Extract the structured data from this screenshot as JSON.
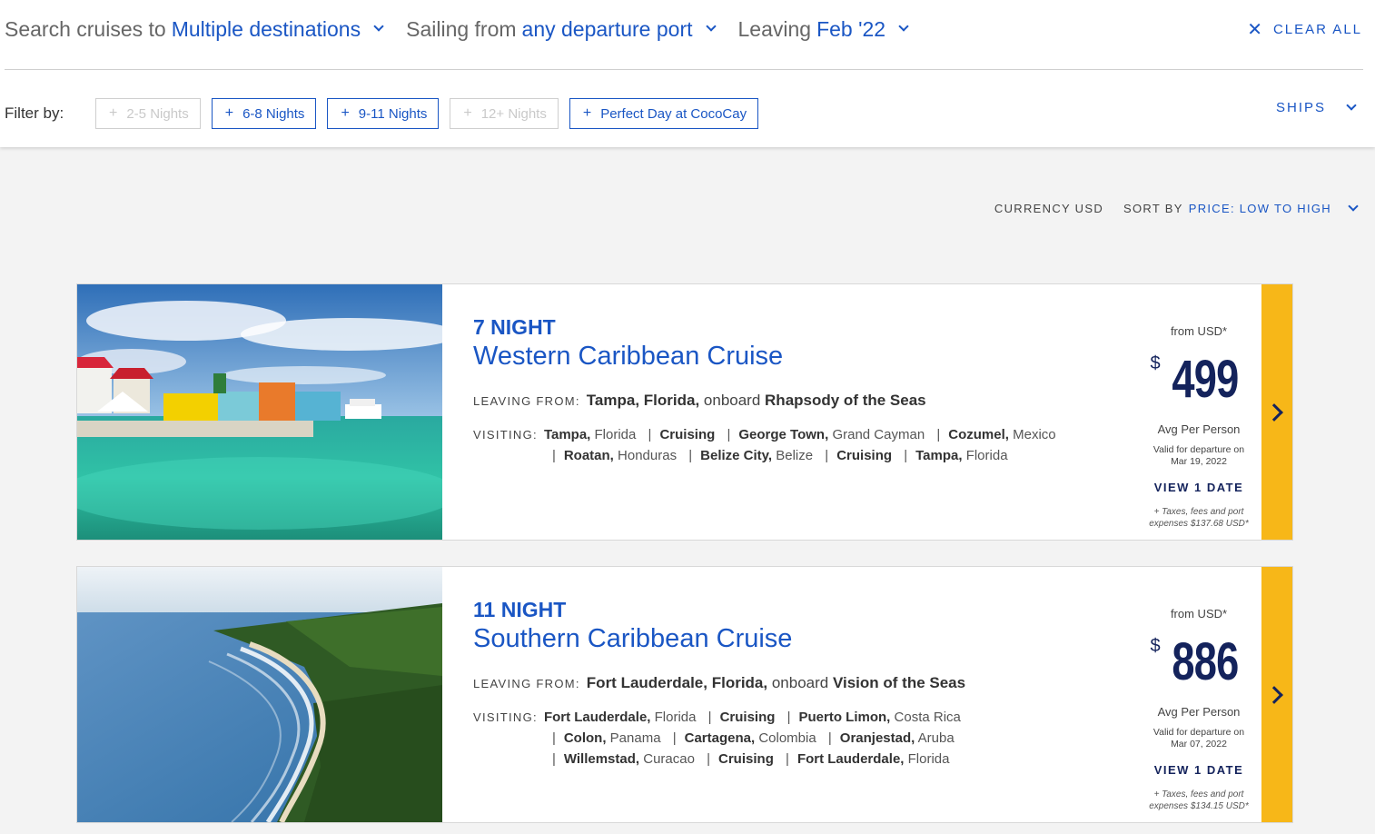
{
  "search": {
    "destination_prefix": "Search cruises to",
    "destination_value": "Multiple destinations",
    "port_prefix": "Sailing from",
    "port_value": "any departure port",
    "date_prefix": "Leaving",
    "date_value": "Feb '22",
    "clear_icon": "✕",
    "clear_label": "CLEAR ALL"
  },
  "filters": {
    "label": "Filter by:",
    "chips": [
      {
        "label": "2-5 Nights",
        "enabled": false
      },
      {
        "label": "6-8 Nights",
        "enabled": true
      },
      {
        "label": "9-11 Nights",
        "enabled": true
      },
      {
        "label": "12+ Nights",
        "enabled": false
      },
      {
        "label": "Perfect Day at CocoCay",
        "enabled": true
      }
    ],
    "plus": "+",
    "ships_label": "SHIPS"
  },
  "sort": {
    "currency": "CURRENCY USD",
    "sort_prefix": "SORT BY",
    "sort_value": "PRICE: LOW TO HIGH"
  },
  "colors": {
    "brand_blue": "#1a56c4",
    "navy": "#14235c",
    "accent_yellow": "#f7b718"
  },
  "cruises": [
    {
      "nights": "7 NIGHT",
      "name": "Western Caribbean Cruise",
      "leaving_label": "LEAVING FROM:",
      "leaving_city": "Tampa, Florida,",
      "onboard": "onboard",
      "ship": "Rhapsody of the Seas",
      "visiting_label": "VISITING:",
      "ports": [
        {
          "city": "Tampa,",
          "region": "Florida"
        },
        {
          "city": "Cruising",
          "region": ""
        },
        {
          "city": "George Town,",
          "region": "Grand Cayman"
        },
        {
          "city": "Cozumel,",
          "region": "Mexico"
        },
        {
          "city": "Roatan,",
          "region": "Honduras"
        },
        {
          "city": "Belize City,",
          "region": "Belize"
        },
        {
          "city": "Cruising",
          "region": ""
        },
        {
          "city": "Tampa,",
          "region": "Florida"
        }
      ],
      "from_label": "from USD*",
      "currency_symbol": "$",
      "price": "499",
      "avg_label": "Avg Per Person",
      "valid_line1": "Valid for departure on",
      "valid_line2": "Mar 19, 2022",
      "view_label": "VIEW 1 DATE",
      "taxes_line1": "+ Taxes, fees and port",
      "taxes_line2": "expenses $137.68 USD*"
    },
    {
      "nights": "11 NIGHT",
      "name": "Southern Caribbean Cruise",
      "leaving_label": "LEAVING FROM:",
      "leaving_city": "Fort Lauderdale, Florida,",
      "onboard": "onboard",
      "ship": "Vision of the Seas",
      "visiting_label": "VISITING:",
      "ports": [
        {
          "city": "Fort Lauderdale,",
          "region": "Florida"
        },
        {
          "city": "Cruising",
          "region": ""
        },
        {
          "city": "Puerto Limon,",
          "region": "Costa Rica"
        },
        {
          "city": "Colon,",
          "region": "Panama"
        },
        {
          "city": "Cartagena,",
          "region": "Colombia"
        },
        {
          "city": "Oranjestad,",
          "region": "Aruba"
        },
        {
          "city": "Willemstad,",
          "region": "Curacao"
        },
        {
          "city": "Cruising",
          "region": ""
        },
        {
          "city": "Fort Lauderdale,",
          "region": "Florida"
        }
      ],
      "from_label": "from USD*",
      "currency_symbol": "$",
      "price": "886",
      "avg_label": "Avg Per Person",
      "valid_line1": "Valid for departure on",
      "valid_line2": "Mar 07, 2022",
      "view_label": "VIEW 1 DATE",
      "taxes_line1": "+ Taxes, fees and port",
      "taxes_line2": "expenses $134.15 USD*"
    }
  ]
}
